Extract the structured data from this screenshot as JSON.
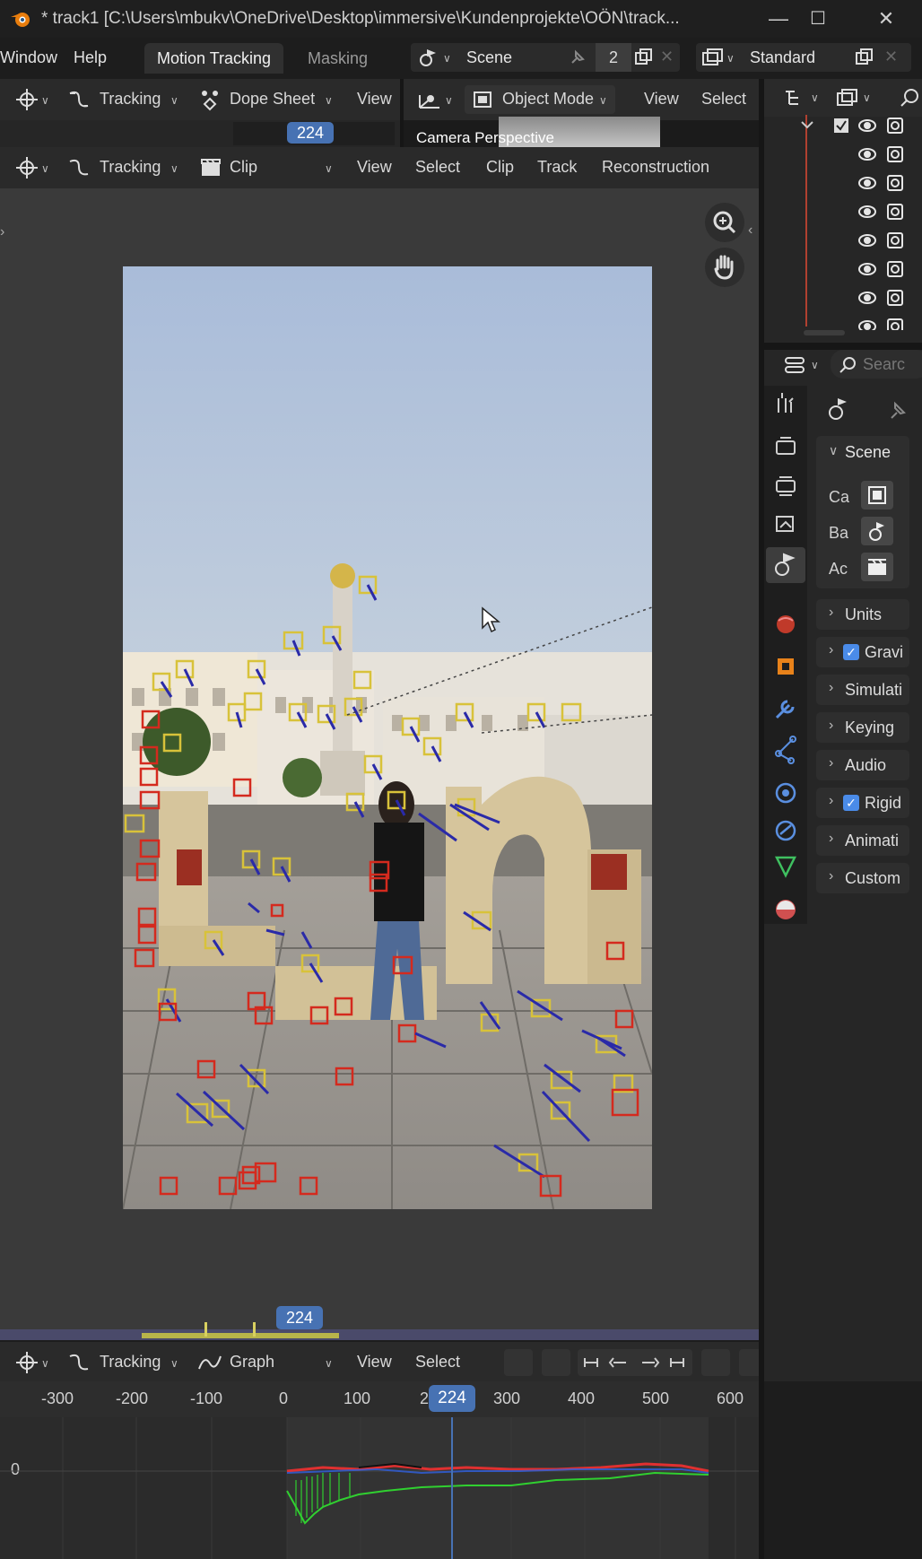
{
  "window": {
    "title": "* track1 [C:\\Users\\mbukv\\OneDrive\\Desktop\\immersive\\Kundenprojekte\\OÖN\\track..."
  },
  "menubar": {
    "items": [
      "Window",
      "Help"
    ],
    "workspace_tabs": [
      {
        "label": "Motion Tracking",
        "active": true
      },
      {
        "label": "Masking",
        "active": false
      }
    ],
    "scene_field": "Scene",
    "scene_count": "2",
    "view_layer": "Standard"
  },
  "top_left_editor": {
    "mode": "Tracking",
    "view_type": "Dope Sheet",
    "menu": "View",
    "frame": "224"
  },
  "viewport_3d": {
    "mode": "Object Mode",
    "menus": [
      "View",
      "Select"
    ],
    "overlay_text": "Camera Perspective"
  },
  "clip_editor": {
    "mode": "Tracking",
    "view_type": "Clip",
    "menus": [
      "View",
      "Select",
      "Clip",
      "Track",
      "Reconstruction"
    ]
  },
  "timeline": {
    "current_frame": "224"
  },
  "graph_editor": {
    "mode": "Tracking",
    "view_type": "Graph",
    "menus": [
      "View",
      "Select"
    ],
    "ruler_ticks": [
      "-300",
      "-200",
      "-100",
      "0",
      "100",
      "2",
      "300",
      "400",
      "500",
      "600"
    ],
    "current_frame": "224",
    "y_label": "0"
  },
  "outliner": {
    "rows": 8
  },
  "properties": {
    "search_placeholder": "Searc",
    "scene_panel": "Scene",
    "scene_fields": [
      "Ca",
      "Ba",
      "Ac"
    ],
    "panels": [
      {
        "label": "Units",
        "checkbox": false
      },
      {
        "label": "Gravi",
        "checkbox": true
      },
      {
        "label": "Simulati",
        "checkbox": false
      },
      {
        "label": "Keying",
        "checkbox": false
      },
      {
        "label": "Audio",
        "checkbox": false
      },
      {
        "label": "Rigid",
        "checkbox": true
      },
      {
        "label": "Animati",
        "checkbox": false
      },
      {
        "label": "Custom",
        "checkbox": false
      }
    ]
  },
  "colors": {
    "accent_blue": "#4772b3",
    "track_yellow": "#d8c23a",
    "track_red": "#d42a1e",
    "track_line_blue": "#2a2aa8",
    "curve_red": "#e03030",
    "curve_green": "#30d030",
    "curve_blue": "#3060e0"
  }
}
